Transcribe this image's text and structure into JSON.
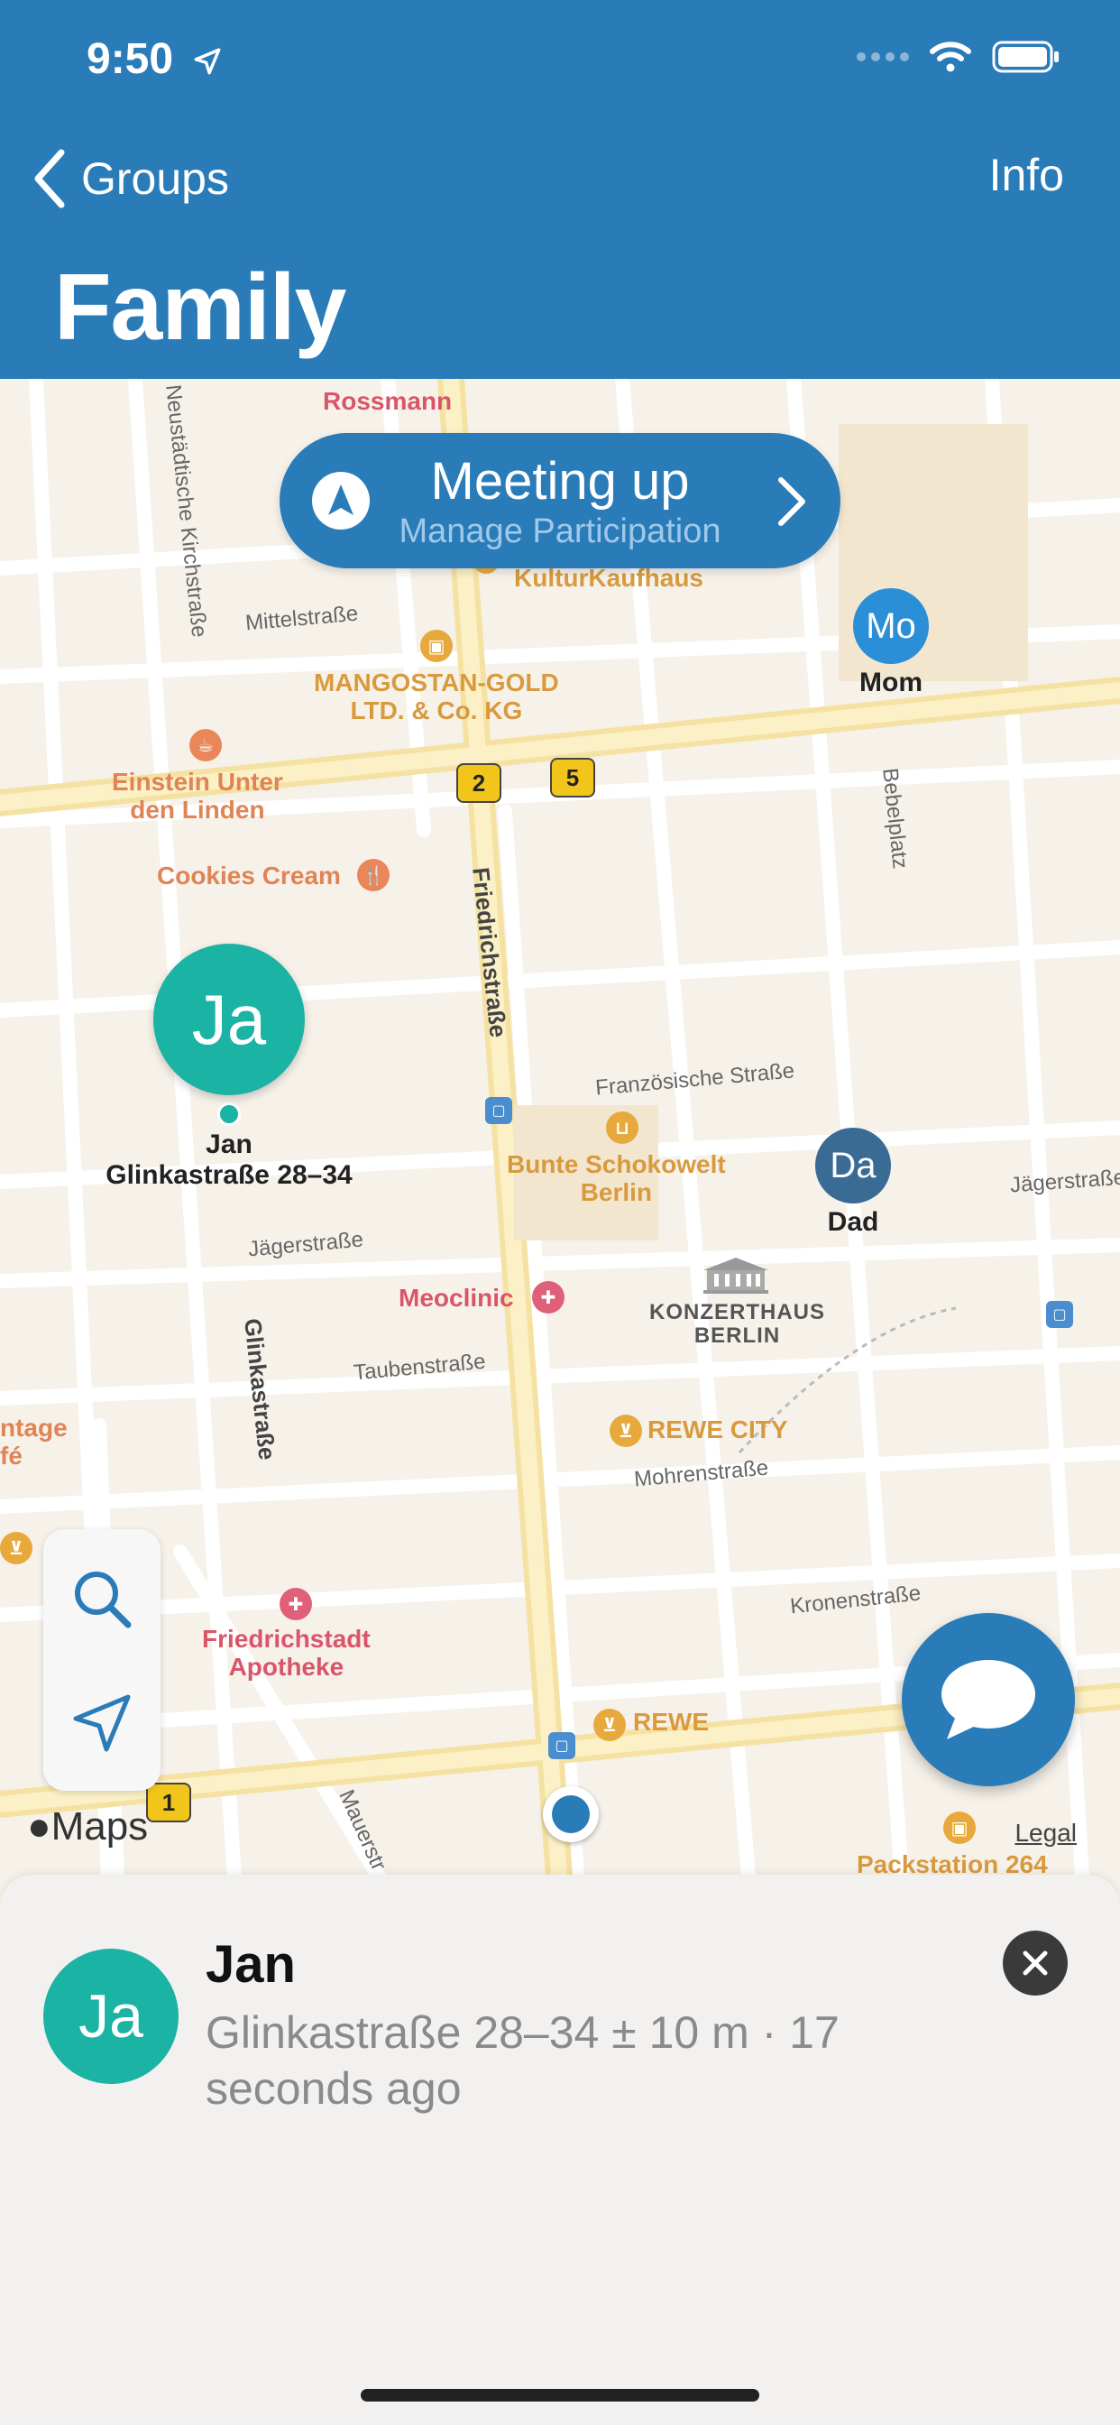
{
  "status_bar": {
    "time": "9:50"
  },
  "nav": {
    "back_label": "Groups",
    "info_label": "Info",
    "title": "Family"
  },
  "meeting": {
    "title": "Meeting up",
    "subtitle": "Manage Participation"
  },
  "map_labels": {
    "rossmann": "Rossmann",
    "kulturkaufhaus": "KulturKaufhaus",
    "mittelstrasse": "Mittelstraße",
    "mangostan": "MANGOSTAN-GOLD\nLTD. & Co. KG",
    "einstein": "Einstein Unter\nden Linden",
    "cookies": "Cookies Cream",
    "friedrichstrasse": "Friedrichstraße",
    "neustaedtische": "Neustädtische Kirchstraße",
    "bebelplatz": "Bebelplatz",
    "franzoesische": "Französische Straße",
    "bunte": "Bunte Schokowelt\nBerlin",
    "jaegerstrasse_left": "Jägerstraße",
    "jaegerstrasse_right": "Jägerstraße",
    "meoclinic": "Meoclinic",
    "konzerthaus": "KONZERTHAUS\nBERLIN",
    "taubenstrasse": "Taubenstraße",
    "glinkastrasse": "Glinkastraße",
    "rewe_city": "REWE CITY",
    "mohrenstrasse": "Mohrenstraße",
    "vintage": "ntage\nfé",
    "friedrichstadt": "Friedrichstadt\nApotheke",
    "kronenstrasse": "Kronenstraße",
    "rewe": "REWE",
    "mauerstrasse": "Mauerstr",
    "packstation": "Packstation 264",
    "badge_2": "2",
    "badge_5": "5",
    "badge_1": "1"
  },
  "members": {
    "mom": {
      "initials": "Mo",
      "name": "Mom",
      "color": "#2a8fd6"
    },
    "dad": {
      "initials": "Da",
      "name": "Dad",
      "color": "#3a6b95"
    },
    "jan": {
      "initials": "Ja",
      "name": "Jan",
      "address": "Glinkastraße 28–34",
      "color": "#1bb3a4"
    }
  },
  "map_footer": {
    "maps_logo": "Maps",
    "legal": "Legal"
  },
  "sheet": {
    "initials": "Ja",
    "name": "Jan",
    "detail": "Glinkastraße 28–34 ± 10 m · 17 seconds ago"
  },
  "colors": {
    "header": "#2a7cb8",
    "accent": "#2a7cb8",
    "jan": "#1bb3a4"
  }
}
